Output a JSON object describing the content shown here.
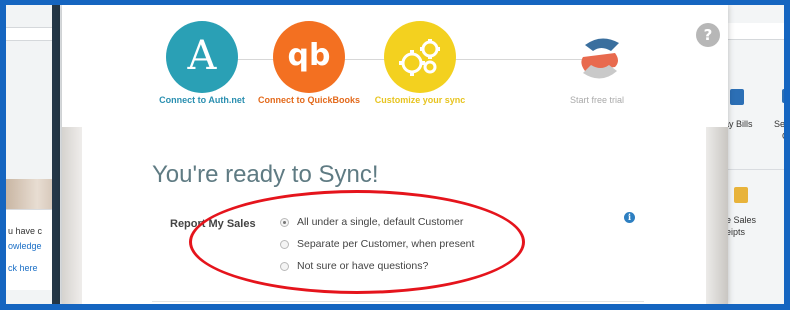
{
  "help_icon": "?",
  "background_left": {
    "line1": "u have c",
    "line2": "owledge",
    "line3": "ck here"
  },
  "background_right": {
    "label1": "ay Bills",
    "label2": "See F",
    "label3": "Op",
    "label4": "e Sales",
    "label5": "eipts"
  },
  "steps": [
    {
      "label": "Connect to Auth.net",
      "glyph": "A",
      "color": "#2aa0b5"
    },
    {
      "label": "Connect to QuickBooks",
      "glyph": "qb",
      "color": "#f37021"
    },
    {
      "label": "Customize your sync",
      "glyph": "gears-icon",
      "color": "#f3d11f"
    },
    {
      "label": "Start free trial",
      "glyph": "s-logo-icon",
      "color": "#aaaaaa"
    }
  ],
  "title": "You're ready to Sync!",
  "report": {
    "label": "Report My Sales",
    "options": [
      {
        "label": "All under a single, default Customer",
        "selected": true
      },
      {
        "label": "Separate per Customer, when present",
        "selected": false
      },
      {
        "label": "Not sure or have questions?",
        "selected": false
      }
    ]
  },
  "info_icon": "i",
  "colors": {
    "frame_border": "#1565c0",
    "annotation": "#e5141c",
    "title": "#5f7b83"
  }
}
